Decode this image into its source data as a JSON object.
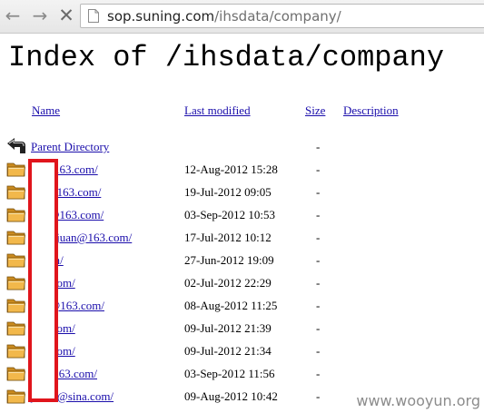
{
  "browser": {
    "url_host": "sop.suning.com",
    "url_path": "/ihsdata/company/"
  },
  "page": {
    "heading": "Index of /ihsdata/company"
  },
  "table": {
    "columns": {
      "name": "Name",
      "last_modified": "Last modified",
      "size": "Size",
      "description": "Description"
    },
    "parent": {
      "name": "Parent Directory",
      "size": "-"
    },
    "rows": [
      {
        "name": "88@163.com/",
        "modified": "12-Aug-2012 15:28",
        "size": "-"
      },
      {
        "name": "hm@163.com/",
        "modified": "19-Jul-2012 09:05",
        "size": "-"
      },
      {
        "name": "042@163.com/",
        "modified": "03-Sep-2012 10:53",
        "size": "-"
      },
      {
        "name": "wangjuan@163.com/",
        "modified": "17-Jul-2012 10:12",
        "size": "-"
      },
      {
        "name": "1.com/",
        "modified": "27-Jun-2012 19:09",
        "size": "-"
      },
      {
        "name": "123.com/",
        "modified": "02-Jul-2012 22:29",
        "size": "-"
      },
      {
        "name": "ikui@163.com/",
        "modified": "08-Aug-2012 11:25",
        "size": "-"
      },
      {
        "name": "145.com/",
        "modified": "09-Jul-2012 21:39",
        "size": "-"
      },
      {
        "name": "147.com/",
        "modified": "09-Jul-2012 21:34",
        "size": "-"
      },
      {
        "name": "zq@163.com/",
        "modified": "03-Sep-2012 11:56",
        "size": "-"
      },
      {
        "name": "jwine@sina.com/",
        "modified": "09-Aug-2012 10:42",
        "size": "-"
      }
    ]
  },
  "watermark": "www.wooyun.org",
  "icons": {
    "back": "back-arrow-icon",
    "forward": "forward-arrow-icon",
    "stop": "stop-icon",
    "page": "page-icon",
    "parent": "parent-directory-icon",
    "folder": "folder-icon"
  },
  "colors": {
    "link": "#1a0dab",
    "redaction": "#e0151c",
    "folder": "#e8a73a"
  }
}
